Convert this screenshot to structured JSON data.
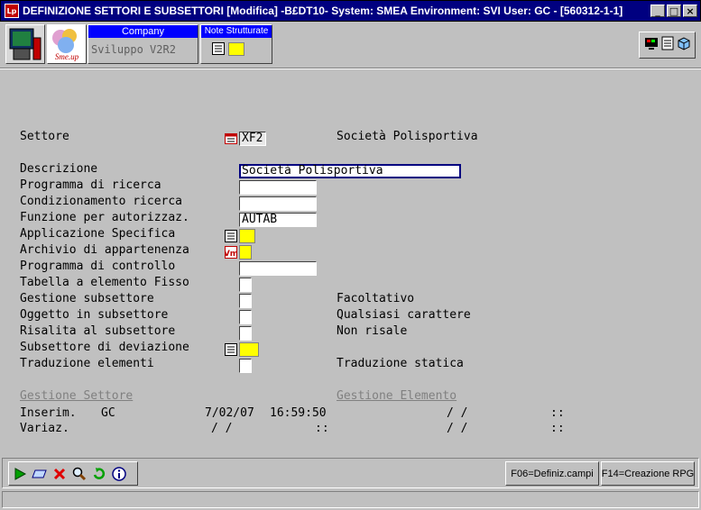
{
  "window": {
    "title": "DEFINIZIONE SETTORI E SUBSETTORI [Modifica] -B£DT10- System: SMEA Environment: SVI User: GC - [560312-1-1]",
    "app_icon_text": "Lp",
    "controls": {
      "minimize": "_",
      "maximize": "□",
      "close": "×"
    }
  },
  "toolbar": {
    "logo_text": "Sme.up",
    "company_header": "Company",
    "company_value": "Sviluppo V2R2",
    "notes_header": "Note Strutturate"
  },
  "form": {
    "settore": {
      "label": "Settore",
      "value": "XF2",
      "desc": "Società Polisportiva"
    },
    "fields": [
      {
        "label": "Descrizione",
        "value": "Società Polisportiva"
      },
      {
        "label": "Programma di ricerca",
        "value": ""
      },
      {
        "label": "Condizionamento ricerca",
        "value": ""
      },
      {
        "label": "Funzione per autorizzaz.",
        "value": "AUTAB"
      },
      {
        "label": "Applicazione Specifica",
        "value": ""
      },
      {
        "label": "Archivio di appartenenza",
        "value": ""
      },
      {
        "label": "Programma di controllo",
        "value": ""
      },
      {
        "label": "Tabella a elemento Fisso",
        "value": "",
        "note": ""
      },
      {
        "label": "Gestione subsettore",
        "value": "",
        "note": "Facoltativo"
      },
      {
        "label": "Oggetto in subsettore",
        "value": "",
        "note": "Qualsiasi carattere"
      },
      {
        "label": "Risalita al subsettore",
        "value": "",
        "note": "Non risale"
      },
      {
        "label": "Subsettore di deviazione",
        "value": ""
      },
      {
        "label": "Traduzione elementi",
        "value": "",
        "note": "Traduzione statica"
      }
    ]
  },
  "audit": {
    "header_settore": "Gestione Settore",
    "header_elemento": "Gestione Elemento",
    "rows": [
      {
        "label": "Inserim.",
        "user": "GC",
        "date": "7/02/07",
        "time": "16:59:50",
        "el_date": "/  /",
        "el_time": "::"
      },
      {
        "label": "Variaz.",
        "user": "",
        "date": "/  /",
        "time": "::",
        "el_date": "/  /",
        "el_time": "::"
      }
    ]
  },
  "footer": {
    "f06": "F06=Definiz.campi",
    "f14": "F14=Creazione RPG"
  },
  "colors": {
    "title_bar": "#000080",
    "header_blue": "#0000ff",
    "yellow": "#ffff00",
    "background": "#c0c0c0"
  }
}
